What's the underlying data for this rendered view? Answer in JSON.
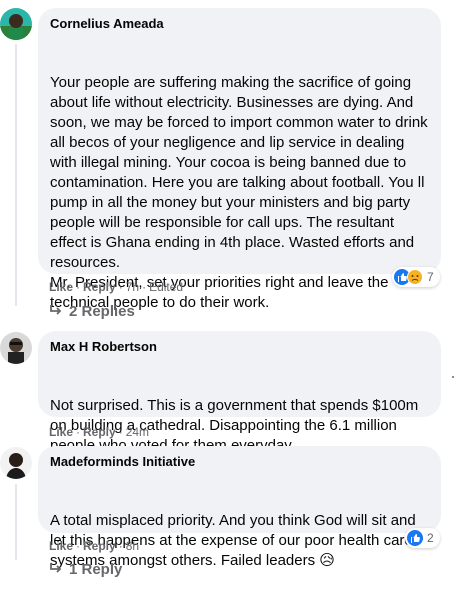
{
  "comments": [
    {
      "author": "Cornelius Ameada",
      "paragraphs": [
        "Your people are suffering making the sacrifice of going about life without electricity. Businesses are dying. And soon, we may be forced to import common water to drink all becos of your negligence and lip service in dealing with illegal mining. Your cocoa is being banned due to contamination. Here you are talking about football. You ll pump in all the money but your ministers and big party people will be responsible for call ups. The resultant effect is Ghana ending in 4th place. Wasted efforts and resources.",
        "Mr. President, set your priorities right and leave the technical people to do their work."
      ],
      "like_label": "Like",
      "reply_label": "Reply",
      "time": "7h",
      "edited": "Edited",
      "reaction_count": "7",
      "replies_label": "2 Replies"
    },
    {
      "author": "Max H Robertson",
      "paragraphs": [
        "Not surprised. This is a government that spends $100m on building a cathedral. Disappointing the 6.1 million people who voted for them everyday"
      ],
      "like_label": "Like",
      "reply_label": "Reply",
      "time": "24m"
    },
    {
      "author": "Madeforminds Initiative",
      "paragraphs": [
        "A total misplaced priority. And you think God will sit and let this happens at the expense of our poor health care systems amongst others. Failed leaders 😥"
      ],
      "like_label": "Like",
      "reply_label": "Reply",
      "time": "8h",
      "reaction_count": "2",
      "replies_label": "1 Reply"
    }
  ],
  "colors": {
    "bubble": "#f0f2f5",
    "meta": "#65676b",
    "like_blue": "#1877f2",
    "sad_yellow": "#f7b125"
  }
}
